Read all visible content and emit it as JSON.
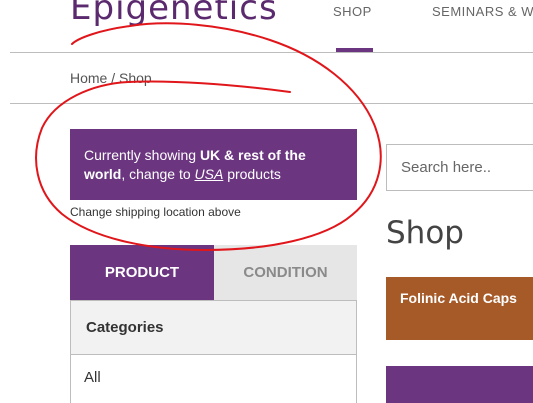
{
  "brand": {
    "logo_text": "Epigenetics"
  },
  "nav": {
    "shop_label": "SHOP",
    "seminars_label": "SEMINARS & W"
  },
  "breadcrumb": "Home / Shop",
  "region_banner": {
    "prefix": "Currently showing ",
    "region": "UK & rest of the world",
    "middle": ", change to ",
    "link": "USA",
    "suffix": " products"
  },
  "shipping_note": "Change shipping location above",
  "search": {
    "placeholder": "Search here.."
  },
  "heading": "Shop",
  "tabs": [
    {
      "label": "PRODUCT",
      "active": true
    },
    {
      "label": "CONDITION",
      "active": false
    }
  ],
  "categories": {
    "title": "Categories",
    "items": [
      "All"
    ]
  },
  "products": [
    {
      "name": "Folinic Acid Caps"
    }
  ],
  "colors": {
    "brand_purple": "#6b3580",
    "product_brown": "#a55a28",
    "annotation_red": "#e0161b"
  }
}
